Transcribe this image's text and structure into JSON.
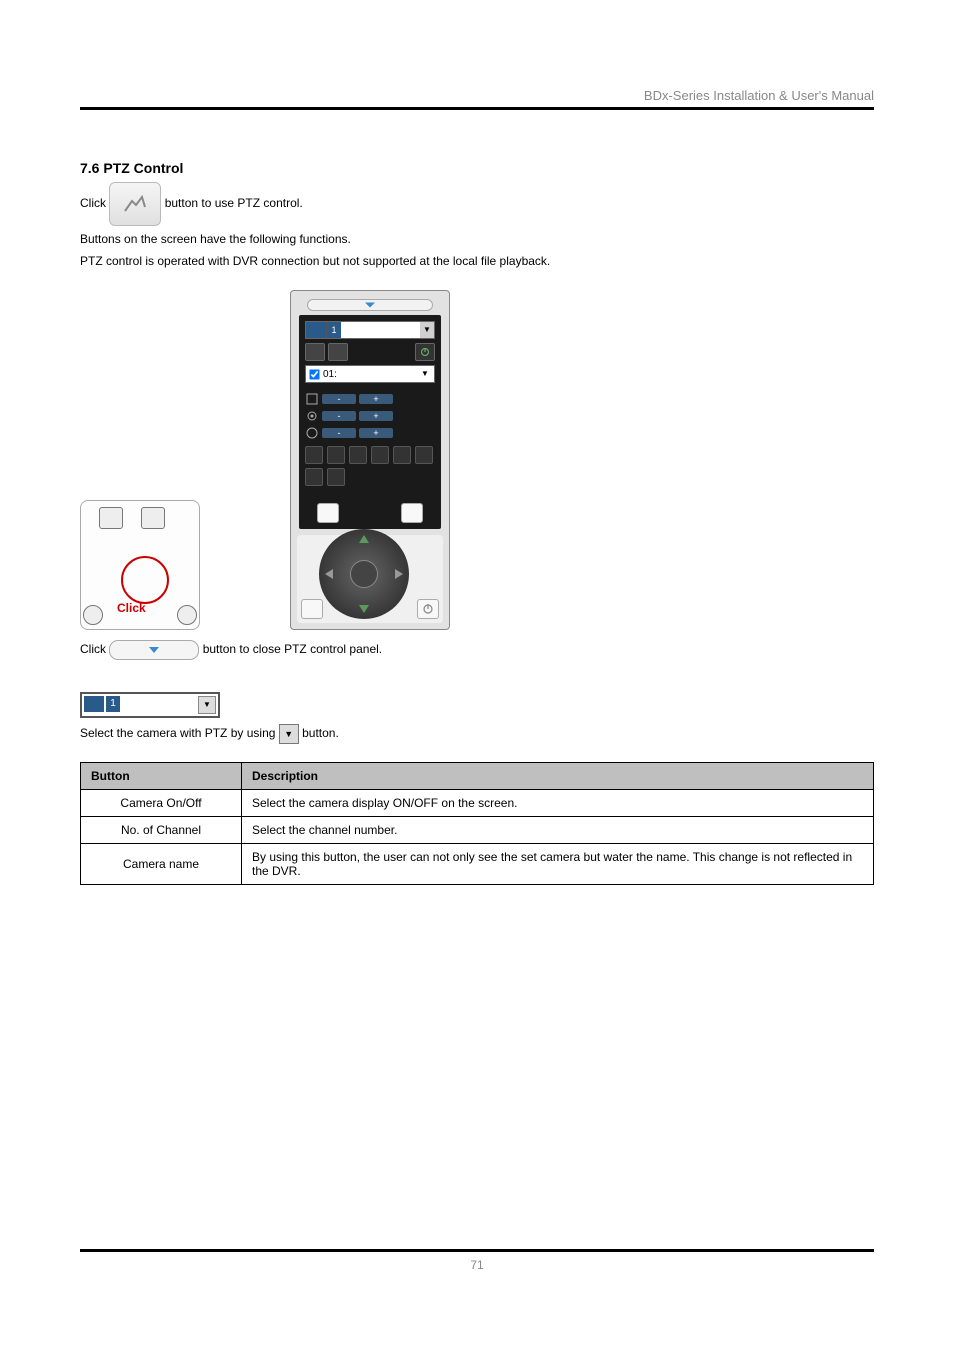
{
  "header": {
    "title": "BDx-Series Installation & User's Manual"
  },
  "section": {
    "title": "7.6 PTZ Control",
    "intro_prefix": "Click",
    "intro_suffix": "button to use PTZ control.",
    "desc_line1": "Buttons on the screen have the following functions.",
    "desc_line2": "PTZ control is operated with DVR connection but not supported at the local file playback."
  },
  "panel": {
    "dd_number": "1",
    "chk_label": "01:",
    "slider_minus": "-",
    "slider_plus": "+"
  },
  "click_label": "Click",
  "ptz_panel_close": {
    "prefix": "Click",
    "suffix": "button to close PTZ control panel."
  },
  "camera_select": {
    "label_prefix": "Select the camera with PTZ by using",
    "dd_number": "1",
    "label_suffix": "button."
  },
  "table": {
    "headers": {
      "button": "Button",
      "desc": "Description"
    },
    "rows": [
      {
        "button": "Camera On/Off",
        "desc": "Select the camera display ON/OFF on the screen."
      },
      {
        "button": "No. of Channel",
        "desc": "Select the channel number."
      },
      {
        "button": "Camera name",
        "desc": "By using this button, the user can not only see the set camera but water the name. This change is not reflected in the DVR."
      }
    ]
  },
  "footer": {
    "page": "71"
  }
}
